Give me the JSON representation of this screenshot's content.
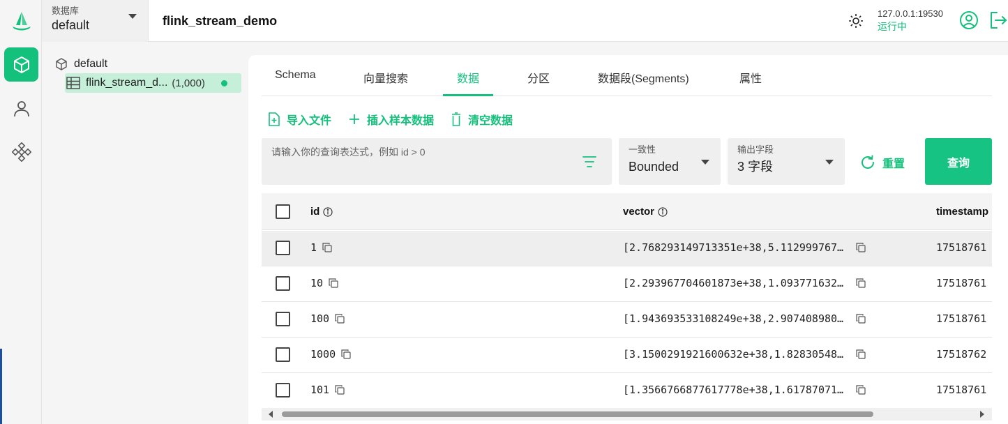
{
  "db_selector": {
    "label": "数据库",
    "value": "default"
  },
  "header": {
    "title": "flink_stream_demo",
    "address": "127.0.0.1:19530",
    "status": "运行中"
  },
  "tree": {
    "database": "default",
    "collection": {
      "name": "flink_stream_d...",
      "count": "(1,000)"
    }
  },
  "tabs": [
    "Schema",
    "向量搜索",
    "数据",
    "分区",
    "数据段(Segments)",
    "属性"
  ],
  "active_tab": "数据",
  "actions": {
    "import": "导入文件",
    "insert_sample": "插入样本数据",
    "clear": "清空数据"
  },
  "query": {
    "placeholder": "请输入你的查询表达式，例如 id > 0",
    "value": ""
  },
  "consistency": {
    "label": "一致性",
    "value": "Bounded"
  },
  "output_fields": {
    "label": "输出字段",
    "value": "3 字段"
  },
  "reset_label": "重置",
  "query_label": "查询",
  "table": {
    "columns": [
      "id",
      "vector",
      "timestamp"
    ],
    "rows": [
      {
        "id": "1",
        "vector": "[2.768293149713351e+38,5.112999767…",
        "timestamp": "17518761"
      },
      {
        "id": "10",
        "vector": "[2.293967704601873e+38,1.093771632…",
        "timestamp": "17518761"
      },
      {
        "id": "100",
        "vector": "[1.943693533108249e+38,2.907408980…",
        "timestamp": "17518761"
      },
      {
        "id": "1000",
        "vector": "[3.1500291921600632e+38,1.82830548…",
        "timestamp": "17518762"
      },
      {
        "id": "101",
        "vector": "[1.3566766877617778e+38,1.61787071…",
        "timestamp": "17518761"
      }
    ]
  },
  "colors": {
    "accent": "#13c07c",
    "selected_bg": "#c6efd9"
  },
  "icons": [
    "logo-icon",
    "collection-cube-icon",
    "user-icon",
    "plugins-icon",
    "theme-sun-icon",
    "user-circle-icon",
    "logout-icon",
    "table-icon",
    "file-add-icon",
    "plus-icon",
    "trash-icon",
    "filter-icon",
    "refresh-icon",
    "info-icon",
    "copy-icon"
  ]
}
